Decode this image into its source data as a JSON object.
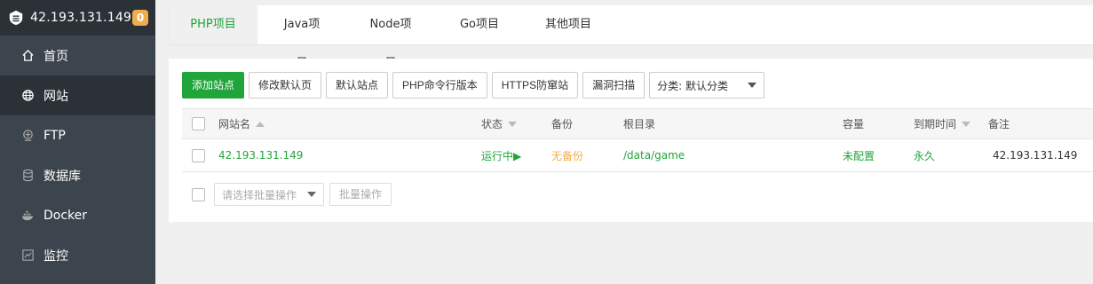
{
  "sidebar": {
    "host": "42.193.131.149",
    "badge": "0",
    "items": [
      {
        "label": "首页",
        "icon": "home-icon"
      },
      {
        "label": "网站",
        "icon": "globe-icon"
      },
      {
        "label": "FTP",
        "icon": "ftp-icon"
      },
      {
        "label": "数据库",
        "icon": "database-icon"
      },
      {
        "label": "Docker",
        "icon": "docker-icon"
      },
      {
        "label": "监控",
        "icon": "monitor-icon"
      }
    ]
  },
  "tabs": [
    {
      "label": "PHP项目"
    },
    {
      "label": "Java项目"
    },
    {
      "label": "Node项目"
    },
    {
      "label": "Go项目"
    },
    {
      "label": "其他项目"
    }
  ],
  "toolbar": {
    "add_site": "添加站点",
    "modify_default": "修改默认页",
    "default_site": "默认站点",
    "php_version": "PHP命令行版本",
    "https_protect": "HTTPS防窜站",
    "vuln_scan": "漏洞扫描",
    "category": "分类: 默认分类"
  },
  "table": {
    "headers": {
      "name": "网站名",
      "status": "状态",
      "backup": "备份",
      "root": "根目录",
      "capacity": "容量",
      "expire": "到期时间",
      "note": "备注"
    },
    "rows": [
      {
        "name": "42.193.131.149",
        "status": "运行中▶",
        "backup": "无备份",
        "root": "/data/game",
        "capacity": "未配置",
        "expire": "永久",
        "note": "42.193.131.149"
      }
    ]
  },
  "footer": {
    "bulk_placeholder": "请选择批量操作",
    "bulk_button": "批量操作"
  },
  "colors": {
    "accent": "#20a53a",
    "sidebar_bg": "#3c444d",
    "sidebar_header_bg": "#2c3138",
    "badge": "#f0ad4e",
    "no_backup": "#f0ad4e"
  }
}
